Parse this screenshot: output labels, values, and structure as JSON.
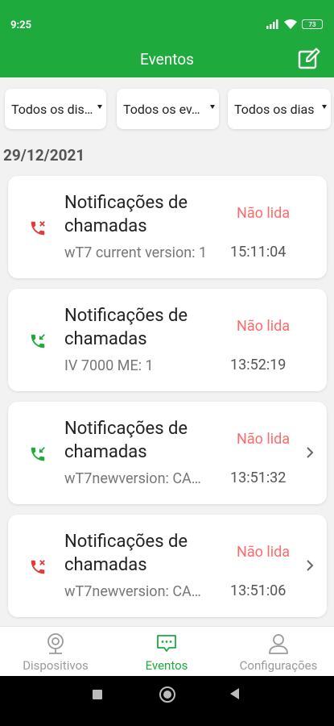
{
  "status_bar": {
    "time": "9:25",
    "battery": "73"
  },
  "header": {
    "title": "Eventos"
  },
  "filters": [
    {
      "label": "Todos os dis…"
    },
    {
      "label": "Todos os ev…"
    },
    {
      "label": "Todos os dias"
    }
  ],
  "date_header": "29/12/2021",
  "events": [
    {
      "title": "Notificações de chamadas",
      "subtitle": "wT7 current version: 1",
      "status": "Não lida",
      "time": "15:11:04",
      "icon": "missed-call-icon",
      "icon_color": "#e53935",
      "has_chevron": false
    },
    {
      "title": "Notificações de chamadas",
      "subtitle": "IV 7000 ME: 1",
      "status": "Não lida",
      "time": "13:52:19",
      "icon": "incoming-call-icon",
      "icon_color": "#1faa3e",
      "has_chevron": false
    },
    {
      "title": "Notificações de chamadas",
      "subtitle": "wT7newversion: CA…",
      "status": "Não lida",
      "time": "13:51:32",
      "icon": "incoming-call-icon",
      "icon_color": "#1faa3e",
      "has_chevron": true
    },
    {
      "title": "Notificações de chamadas",
      "subtitle": "wT7newversion: CA…",
      "status": "Não lida",
      "time": "13:51:06",
      "icon": "missed-call-icon",
      "icon_color": "#e53935",
      "has_chevron": true
    }
  ],
  "bottom_nav": [
    {
      "label": "Dispositivos",
      "icon": "camera-icon",
      "active": false
    },
    {
      "label": "Eventos",
      "icon": "message-icon",
      "active": true
    },
    {
      "label": "Configurações",
      "icon": "user-icon",
      "active": false
    }
  ],
  "colors": {
    "primary": "#1faa3e",
    "unread": "#ff6b6b",
    "missed_call": "#e53935"
  }
}
